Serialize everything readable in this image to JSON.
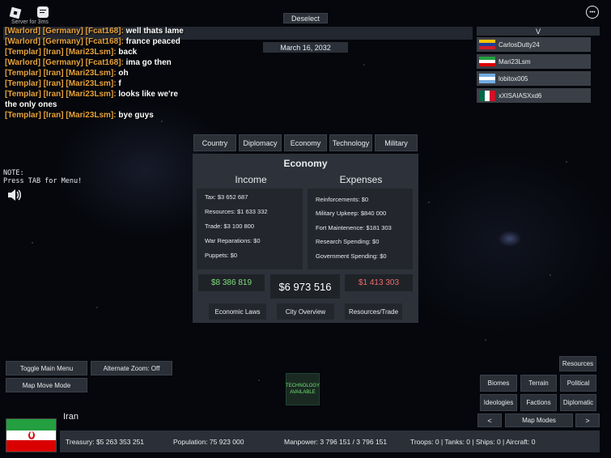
{
  "top": {
    "deselect_label": "Deselect",
    "date": "March 16, 2032",
    "players_header": "V",
    "server_note": "Server for 3ms",
    "menu_dots": "•••"
  },
  "chat": [
    {
      "prefix": "[Warlord] [Germany] [Fcat168]:",
      "message": "well thats lame"
    },
    {
      "prefix": "[Warlord] [Germany] [Fcat168]:",
      "message": "france peaced"
    },
    {
      "prefix": "[Templar] [Iran] [Mari23Lsm]:",
      "message": "back"
    },
    {
      "prefix": "[Warlord] [Germany] [Fcat168]:",
      "message": "ima go then"
    },
    {
      "prefix": "[Templar] [Iran] [Mari23Lsm]:",
      "message": "oh"
    },
    {
      "prefix": "[Templar] [Iran] [Mari23Lsm]:",
      "message": "f"
    },
    {
      "prefix": "[Templar] [Iran] [Mari23Lsm]:",
      "message": "looks like we're the only ones"
    },
    {
      "prefix": "[Templar] [Iran] [Mari23Lsm]:",
      "message": "bye guys"
    }
  ],
  "note": {
    "line1": "NOTE:",
    "line2": "Press TAB for Menu!"
  },
  "players": [
    {
      "name": "CarlosDutty24",
      "flag": "venezuela-flag"
    },
    {
      "name": "Mari23Lsm",
      "flag": "iran-flag"
    },
    {
      "name": "lobitox005",
      "flag": "argentina-flag"
    },
    {
      "name": "xXISAIASXxd6",
      "flag": "mexico-flag"
    }
  ],
  "tabs": [
    "Country",
    "Diplomacy",
    "Economy",
    "Technology",
    "Military"
  ],
  "economy": {
    "title": "Economy",
    "income_title": "Income",
    "expenses_title": "Expenses",
    "income": [
      "Tax: $3 652 687",
      "Resources: $1 633 332",
      "Trade: $3 100 800",
      "War Reparations: $0",
      "Puppets: $0"
    ],
    "expenses": [
      "Reinforcements: $0",
      "Military Upkeep: $840 000",
      "Fort Maintenence: $181 303",
      "Research Spending: $0",
      "Government Spending: $0"
    ],
    "income_total": "$8 386 819",
    "balance": "$6 973 516",
    "expenses_total": "$1 413 303",
    "buttons": [
      "Economic Laws",
      "City Overview",
      "Resources/Trade"
    ],
    "colors": {
      "income": "#7ee07a",
      "expenses": "#f06a6a"
    }
  },
  "left_controls": {
    "toggle_main_menu": "Toggle Main Menu",
    "alternate_zoom": "Alternate Zoom: Off",
    "map_move_mode": "Map Move Mode"
  },
  "tech_notice": "TECHNOLOGY AVAILABLE",
  "map_controls": {
    "resources": "Resources",
    "biomes": "Biomes",
    "terrain": "Terrain",
    "political": "Political",
    "ideologies": "Ideologies",
    "factions": "Factions",
    "diplomatic": "Diplomatic",
    "prev": "<",
    "map_modes": "Map Modes",
    "next": ">"
  },
  "country": {
    "name": "Iran",
    "flag": "iran-flag",
    "treasury": "Treasury:   $5 263 353 251",
    "population": "Population: 75 923 000",
    "manpower": "Manpower:  3 796 151  /  3 796 151",
    "military": "Troops: 0  |  Tanks: 0  |  Ships: 0  |  Aircraft: 0"
  }
}
